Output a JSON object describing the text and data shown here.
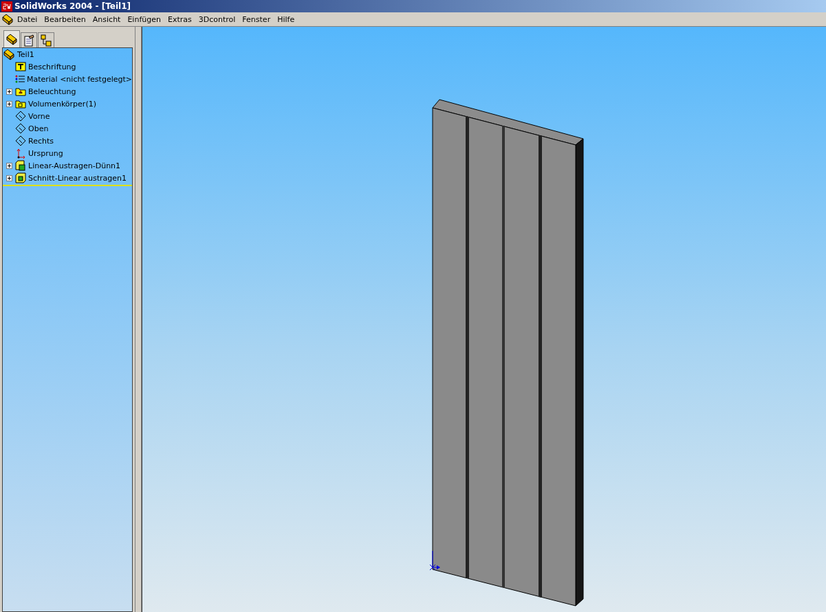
{
  "window": {
    "title": "SolidWorks 2004 - [Teil1]"
  },
  "menu": [
    "Datei",
    "Bearbeiten",
    "Ansicht",
    "Einfügen",
    "Extras",
    "3Dcontrol",
    "Fenster",
    "Hilfe"
  ],
  "panel_tabs": [
    {
      "kind": "part",
      "selected": true
    },
    {
      "kind": "property",
      "selected": false
    },
    {
      "kind": "config",
      "selected": false
    }
  ],
  "tree": {
    "label": "Teil1",
    "children": [
      {
        "label": "Beschriftung",
        "kind": "annotation"
      },
      {
        "label": "Material <nicht festgelegt>",
        "kind": "material"
      },
      {
        "label": "Beleuchtung",
        "kind": "lighting",
        "expanded": false
      },
      {
        "label": "Volumenkörper(1)",
        "kind": "bodies",
        "expanded": false
      },
      {
        "label": "Vorne",
        "kind": "plane"
      },
      {
        "label": "Oben",
        "kind": "plane"
      },
      {
        "label": "Rechts",
        "kind": "plane"
      },
      {
        "label": "Ursprung",
        "kind": "origin"
      },
      {
        "label": "Linear-Austragen-Dünn1",
        "kind": "extrude",
        "expanded": false
      },
      {
        "label": "Schnitt-Linear austragen1",
        "kind": "cut",
        "expanded": false
      }
    ]
  }
}
